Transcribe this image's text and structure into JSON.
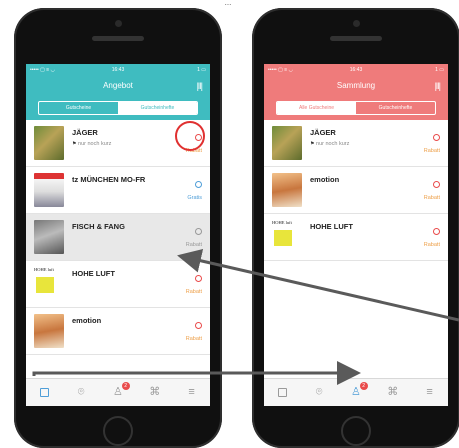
{
  "caption": "...",
  "left": {
    "status": {
      "carrier": "••••• ▢ ≡ ◡",
      "time": "16:43",
      "battery": "1 ▭"
    },
    "nav_title": "Angebot",
    "filter_icon": "sliders-icon",
    "segments": [
      "Gutscheine",
      "Gutscheinhefte"
    ],
    "active_segment": 1,
    "rows": [
      {
        "title": "JÄGER",
        "sub": "nur noch kurz",
        "status": "Rabatt"
      },
      {
        "title": "tz MÜNCHEN MO-FR",
        "sub": "",
        "status": "Gratis"
      },
      {
        "title": "FISCH & FANG",
        "sub": "",
        "status": "Rabatt"
      },
      {
        "title": "HOHE LUFT",
        "sub": "",
        "status": "Rabatt"
      },
      {
        "title": "emotion",
        "sub": "",
        "status": "Rabatt"
      }
    ],
    "tab_badge": "2"
  },
  "right": {
    "status": {
      "carrier": "••••• ▢ ≡ ◡",
      "time": "16:43",
      "battery": "1 ▭"
    },
    "nav_title": "Sammlung",
    "filter_icon": "sliders-icon",
    "segments": [
      "Alle Gutscheine",
      "Gutscheinhefte"
    ],
    "active_segment": 0,
    "rows": [
      {
        "title": "JÄGER",
        "sub": "nur noch kurz",
        "status": "Rabatt"
      },
      {
        "title": "emotion",
        "sub": "",
        "status": "Rabatt"
      },
      {
        "title": "HOHE LUFT",
        "sub": "",
        "status": "Rabatt"
      }
    ],
    "tab_badge": "2"
  },
  "thumb_text": {
    "luft_logo": "HOHE luft"
  },
  "colors": {
    "teal": "#3fbcc0",
    "coral": "#ef7b7b",
    "accent_blue": "#4f9ed8",
    "orange": "#eda04a",
    "red": "#e94b4b"
  },
  "icons": [
    "sliders-icon",
    "cards-icon",
    "location-icon",
    "profile-icon",
    "qr-code-icon",
    "menu-icon",
    "flag-icon"
  ]
}
